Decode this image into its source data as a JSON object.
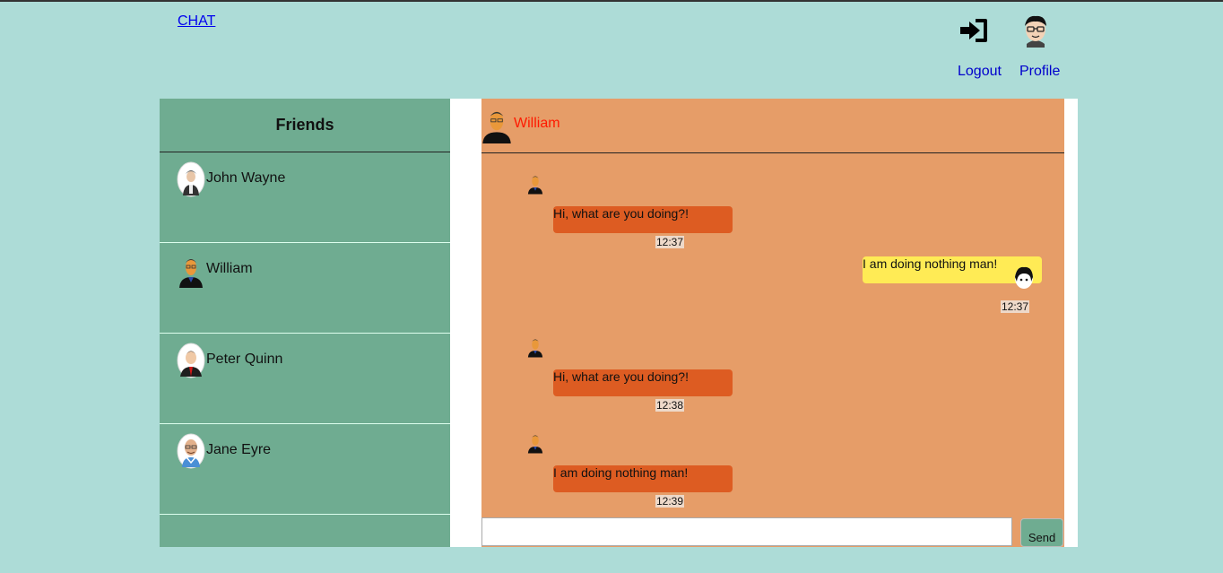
{
  "nav": {
    "brand": "CHAT",
    "logout_label": "Logout",
    "profile_label": "Profile"
  },
  "friends": {
    "title": "Friends",
    "items": [
      {
        "name": "John Wayne"
      },
      {
        "name": "William"
      },
      {
        "name": "Peter Quinn"
      },
      {
        "name": "Jane Eyre"
      }
    ]
  },
  "chat": {
    "contact_name": "William",
    "messages": [
      {
        "direction": "in",
        "text": "Hi, what are you doing?!",
        "time": "12:37"
      },
      {
        "direction": "out",
        "text": "I am doing nothing man!",
        "time": "12:37"
      },
      {
        "direction": "in",
        "text": "Hi, what are you doing?!",
        "time": "12:38"
      },
      {
        "direction": "in",
        "text": "I am doing nothing man!",
        "time": "12:39"
      }
    ],
    "send_label": "Send",
    "input_value": ""
  },
  "colors": {
    "background": "#addcd7",
    "friends_panel": "#6fac91",
    "chat_panel": "#e69d68",
    "incoming_bubble": "#dd5c22",
    "outgoing_bubble": "#ffeb55",
    "contact_name": "#ff1a00",
    "link": "#0000ee"
  }
}
